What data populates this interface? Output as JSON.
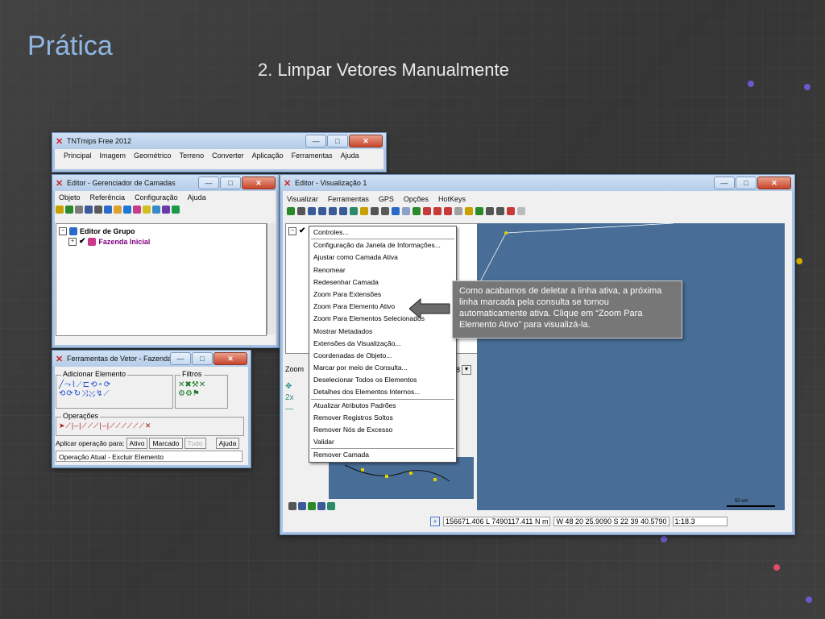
{
  "slide": {
    "title": "Prática",
    "subtitle": "2. Limpar Vetores Manualmente"
  },
  "colors": {
    "title": "#8fb6e3",
    "map_blue": "#486e97",
    "callout_bg": "#777777",
    "group_label": "#800080"
  },
  "tntmips": {
    "title": "TNTmips Free 2012",
    "menu": [
      "Principal",
      "Imagem",
      "Geométrico",
      "Terreno",
      "Converter",
      "Aplicação",
      "Ferramentas",
      "Ajuda"
    ]
  },
  "layer_manager": {
    "title": "Editor - Gerenciador de Camadas",
    "menu": [
      "Objeto",
      "Referência",
      "Configuração",
      "Ajuda"
    ],
    "tree": {
      "group": "Editor de Grupo",
      "layer": "Fazenda Inicial"
    }
  },
  "vector_tools": {
    "title": "Ferramentas de Vetor - Fazenda I...",
    "add_element_legend": "Adicionar Elemento",
    "filters_legend": "Filtros",
    "operations_legend": "Operações",
    "apply_label": "Aplicar operação para:",
    "apply_buttons": [
      "Ativo",
      "Marcado",
      "Tudo"
    ],
    "help_button": "Ajuda",
    "current_operation": "Operação Atual - Excluir Elemento"
  },
  "view_window": {
    "title": "Editor - Visualização 1",
    "menu": [
      "Visualizar",
      "Ferramentas",
      "GPS",
      "Opções",
      "HotKeys"
    ],
    "zoom_label": "Zoom",
    "zoom_value": "8",
    "scale_label": "50 cm",
    "status": {
      "coords_ne": "156671.406 L  7490117.411 N m",
      "coords_latlon": "W 48 20 25.9090  S 22 39 40.5790",
      "scale": "1:18.3"
    }
  },
  "context_menu": {
    "groups": [
      [
        "Controles..."
      ],
      [
        "Configuração da Janela de Informações...",
        "Ajustar como Camada Ativa",
        "Renomear",
        "Redesenhar Camada",
        "Zoom Para Extensões",
        "Zoom Para Elemento Ativo",
        "Zoom Para Elementos Selecionados",
        "Mostrar Metadados",
        "Extensões da Visualização...",
        "Coordenadas de Objeto...",
        "Marcar por meio de Consulta...",
        "Deselecionar Todos os Elementos",
        "Detalhes dos Elementos Internos..."
      ],
      [
        "Atualizar Atributos Padrões",
        "Remover Registros Soltos",
        "Remover Nós de Excesso",
        "Validar"
      ],
      [
        "Remover Camada"
      ]
    ]
  },
  "callout": {
    "text": "Como acabamos de deletar a linha ativa, a próxima linha marcada pela consulta se tornou automaticamente ativa. Clique em “Zoom Para Elemento Ativo” para visualizá-la."
  }
}
